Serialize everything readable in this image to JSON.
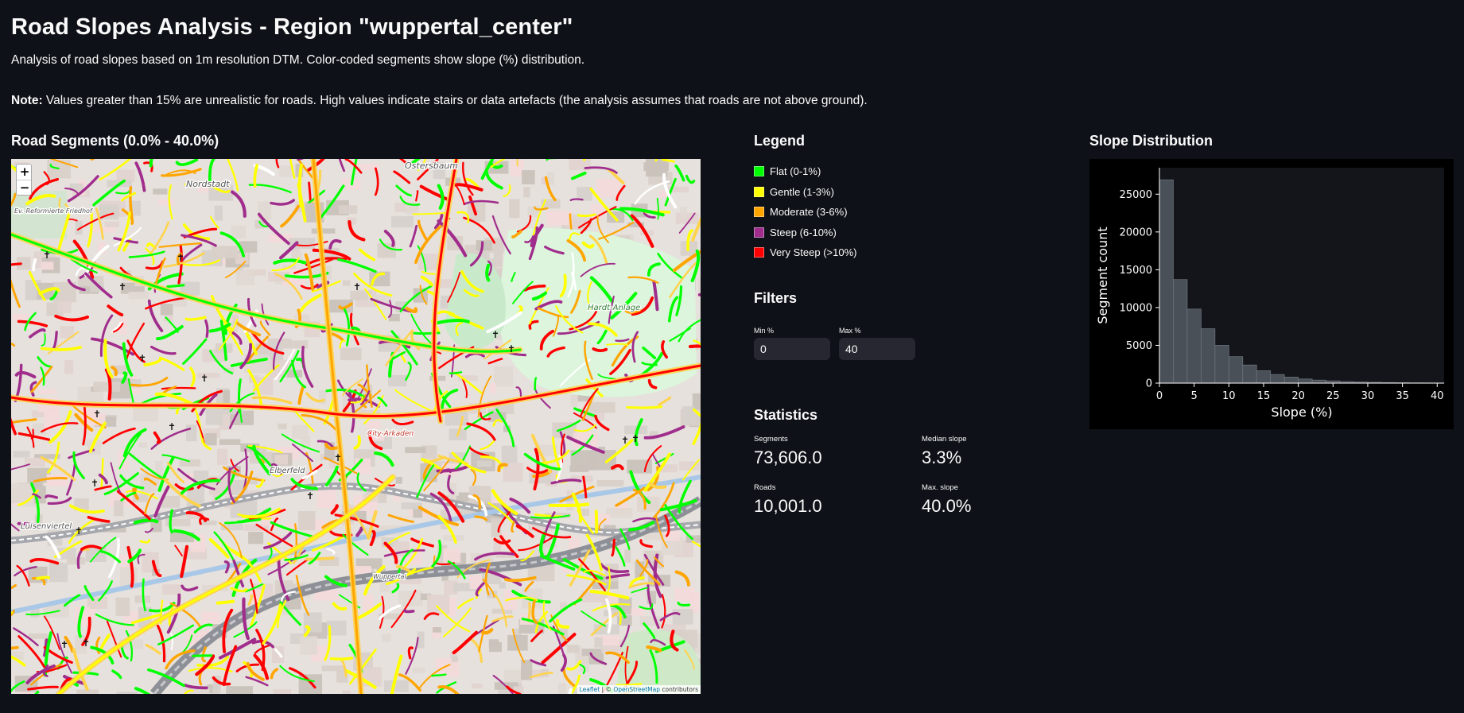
{
  "page": {
    "title": "Road Slopes Analysis - Region \"wuppertal_center\"",
    "description": "Analysis of road slopes based on 1m resolution DTM. Color-coded segments show slope (%) distribution.",
    "note_label": "Note:",
    "note_text": " Values greater than 15% are unrealistic for roads. High values indicate stairs or data artefacts (the analysis assumes that roads are not above ground)."
  },
  "map": {
    "title": "Road Segments (0.0% - 40.0%)",
    "zoom_in": "+",
    "zoom_out": "−",
    "labels": [
      "Nordstadt",
      "Ostersbaum",
      "Hardt-Anlage",
      "Elberfeld",
      "City-Arkaden",
      "Luisenviertel",
      "Ev.-Reformierte Friedhof",
      "Wuppertal"
    ],
    "attribution": {
      "leaflet": "Leaflet",
      "separator": " | © ",
      "osm": "OpenStreetMap",
      "contributors": " contributors"
    }
  },
  "legend": {
    "title": "Legend",
    "items": [
      {
        "label": "Flat (0-1%)",
        "color": "#00ff00"
      },
      {
        "label": "Gentle (1-3%)",
        "color": "#ffff00"
      },
      {
        "label": "Moderate (3-6%)",
        "color": "#ffa500"
      },
      {
        "label": "Steep (6-10%)",
        "color": "#a02c8c"
      },
      {
        "label": "Very Steep (>10%)",
        "color": "#ff0000"
      }
    ]
  },
  "filters": {
    "title": "Filters",
    "min_label": "Min %",
    "min_value": "0",
    "max_label": "Max %",
    "max_value": "40"
  },
  "statistics": {
    "title": "Statistics",
    "segments_label": "Segments",
    "segments_value": "73,606.0",
    "median_label": "Median slope",
    "median_value": "3.3%",
    "roads_label": "Roads",
    "roads_value": "10,001.0",
    "max_label": "Max. slope",
    "max_value": "40.0%"
  },
  "histogram": {
    "title": "Slope Distribution"
  },
  "chart_data": {
    "type": "bar",
    "xlabel": "Slope (%)",
    "ylabel": "Segment count",
    "xlim": [
      0,
      41
    ],
    "ylim": [
      0,
      28500
    ],
    "xticks": [
      0,
      5,
      10,
      15,
      20,
      25,
      30,
      35,
      40
    ],
    "yticks": [
      0,
      5000,
      10000,
      15000,
      20000,
      25000
    ],
    "bin_width": 2,
    "bin_starts": [
      0,
      2,
      4,
      6,
      8,
      10,
      12,
      14,
      16,
      18,
      20,
      22,
      24,
      26,
      28,
      30,
      32,
      34,
      36,
      38,
      40
    ],
    "values": [
      26900,
      13700,
      9800,
      7200,
      5000,
      3500,
      2400,
      1650,
      1150,
      800,
      550,
      400,
      300,
      200,
      150,
      110,
      80,
      60,
      40,
      30,
      20
    ],
    "bar_color": "#4a5058"
  }
}
